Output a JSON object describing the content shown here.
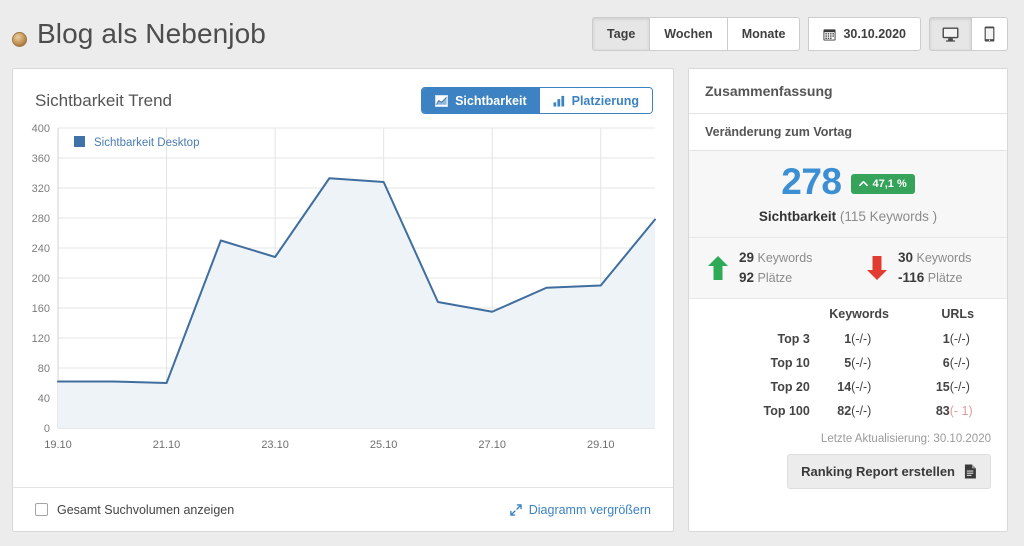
{
  "header": {
    "title": "Blog als Nebenjob",
    "avatar_icon": "user-avatar-icon",
    "range_buttons": [
      {
        "label": "Tage",
        "active": true
      },
      {
        "label": "Wochen",
        "active": false
      },
      {
        "label": "Monate",
        "active": false
      }
    ],
    "date_button": {
      "label": "30.10.2020",
      "icon": "calendar-icon"
    },
    "device_buttons": [
      {
        "icon": "desktop-icon",
        "active": true
      },
      {
        "icon": "mobile-icon",
        "active": false
      }
    ]
  },
  "chart_panel": {
    "title": "Sichtbarkeit Trend",
    "segmented": [
      {
        "label": "Sichtbarkeit",
        "icon": "chart-area-icon",
        "active": true
      },
      {
        "label": "Platzierung",
        "icon": "bar-chart-icon",
        "active": false
      }
    ],
    "footer": {
      "checkbox_label": "Gesamt Suchvolumen anzeigen",
      "checkbox_checked": false,
      "enlarge_label": "Diagramm vergrößern",
      "enlarge_icon": "expand-icon"
    }
  },
  "chart_data": {
    "type": "area",
    "title": "Sichtbarkeit Trend",
    "xlabel": "",
    "ylabel": "",
    "ylim": [
      0,
      400
    ],
    "yticks": [
      0,
      40,
      80,
      120,
      160,
      200,
      240,
      280,
      320,
      360,
      400
    ],
    "grid": true,
    "legend_position": "top-left",
    "legend": [
      "Sichtbarkeit Desktop"
    ],
    "x": [
      "19.10",
      "20.10",
      "21.10",
      "22.10",
      "23.10",
      "24.10",
      "25.10",
      "26.10",
      "27.10",
      "28.10",
      "29.10",
      "30.10"
    ],
    "xtick_labels": [
      "19.10",
      "21.10",
      "23.10",
      "25.10",
      "27.10",
      "29.10"
    ],
    "series": [
      {
        "name": "Sichtbarkeit Desktop",
        "color": "#3f6e9e",
        "fill": "#eef3f8",
        "values": [
          62,
          62,
          60,
          250,
          228,
          333,
          328,
          168,
          155,
          187,
          190,
          278
        ]
      }
    ]
  },
  "summary": {
    "panel_title": "Zusammenfassung",
    "section_title": "Veränderung zum Vortag",
    "kpi": {
      "value": "278",
      "badge": "47,1 %",
      "badge_icon": "chevron-up-icon",
      "badge_color": "#36a35b",
      "caption_bold": "Sichtbarkeit",
      "caption_rest": "(115 Keywords )"
    },
    "movers": {
      "up": {
        "icon": "arrow-up-icon",
        "icon_color": "#2eaa57",
        "count": "29",
        "count_label": "Keywords",
        "places": "92",
        "places_label": "Plätze"
      },
      "down": {
        "icon": "arrow-down-icon",
        "icon_color": "#e03c31",
        "count": "30",
        "count_label": "Keywords",
        "places": "-116",
        "places_label": "Plätze"
      }
    },
    "table": {
      "columns": [
        "",
        "Keywords",
        "URLs"
      ],
      "rows": [
        {
          "label": "Top 3",
          "keywords": "1",
          "keywords_delta": "(-/-)",
          "urls": "1",
          "urls_delta": "(-/-)",
          "urls_delta_negative": false
        },
        {
          "label": "Top 10",
          "keywords": "5",
          "keywords_delta": "(-/-)",
          "urls": "6",
          "urls_delta": "(-/-)",
          "urls_delta_negative": false
        },
        {
          "label": "Top 20",
          "keywords": "14",
          "keywords_delta": "(-/-)",
          "urls": "15",
          "urls_delta": "(-/-)",
          "urls_delta_negative": false
        },
        {
          "label": "Top 100",
          "keywords": "82",
          "keywords_delta": "(-/-)",
          "urls": "83",
          "urls_delta": "(- 1)",
          "urls_delta_negative": true
        }
      ]
    },
    "last_update": "Letzte Aktualisierung: 30.10.2020",
    "report_button": {
      "label": "Ranking Report erstellen",
      "icon": "document-icon"
    }
  }
}
